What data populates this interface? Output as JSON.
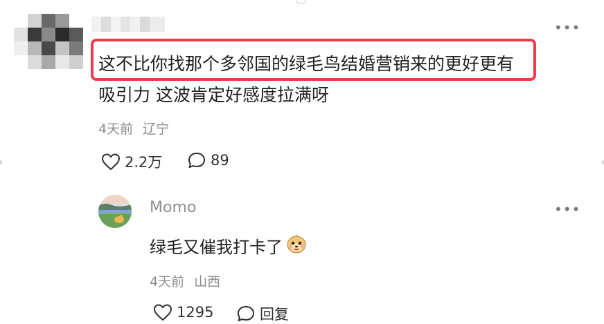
{
  "comment": {
    "username": "",
    "text": "这不比你找那个多邻国的绿毛鸟结婚营销来的更好更有吸引力 这波肯定好感度拉满呀",
    "text_line1": "这不比你找那个多邻国的绿毛鸟结婚营销来的更好更有",
    "text_line2": "吸引力 这波肯定好感度拉满呀",
    "time": "4天前",
    "location": "辽宁",
    "likes": "2.2万",
    "replies": "89",
    "like_icon": "heart-icon",
    "reply_icon": "comment-bubble-icon",
    "more_icon": "more-horizontal-icon"
  },
  "reply": {
    "username": "Momo",
    "text": "绿毛又催我打卡了",
    "emoji": "smiling-face-emoji",
    "time": "4天前",
    "location": "山西",
    "likes": "1295",
    "reply_label": "回复",
    "like_icon": "heart-icon",
    "reply_icon": "comment-bubble-icon",
    "more_icon": "more-horizontal-icon"
  },
  "highlight_color": "#ee3b4a"
}
